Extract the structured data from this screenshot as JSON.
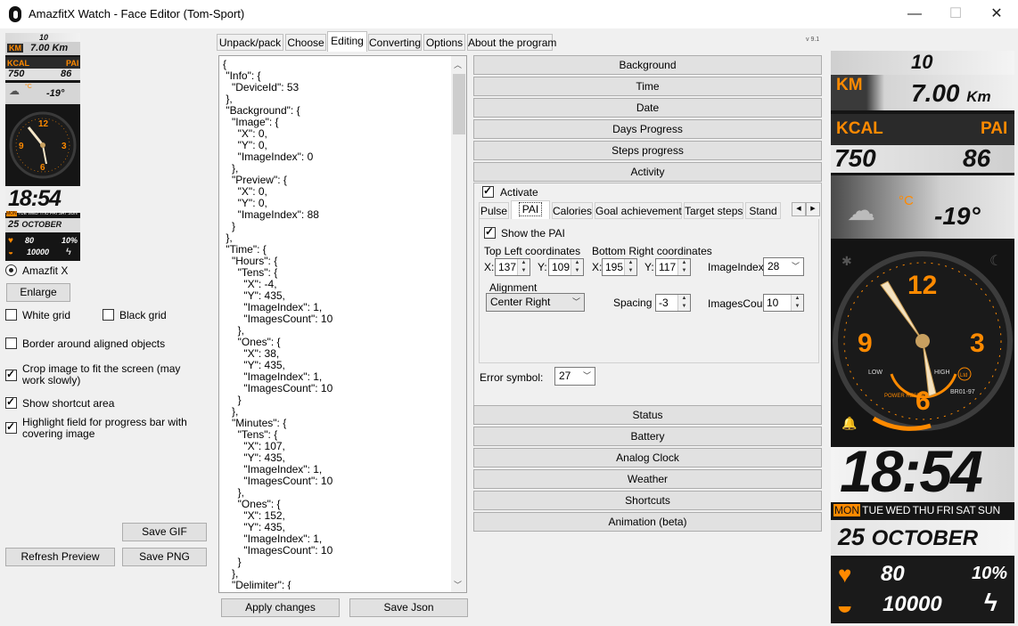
{
  "window": {
    "title": "AmazfitX Watch - Face Editor (Tom-Sport)",
    "minimize": "—",
    "maximize": "☐",
    "close": "✕"
  },
  "version": "v 9.1",
  "tabs": [
    "Unpack/pack",
    "Choose",
    "Editing",
    "Converting",
    "Options",
    "About the program"
  ],
  "left": {
    "device_radio": "Amazfit X",
    "enlarge": "Enlarge",
    "white_grid": "White grid",
    "black_grid": "Black grid",
    "border_aligned": "Border around aligned objects",
    "crop_image": "Crop image to fit the screen (may work slowly)",
    "show_shortcut": "Show shortcut area",
    "highlight_field": "Highlight field for progress bar with covering image",
    "save_gif": "Save GIF",
    "refresh_preview": "Refresh Preview",
    "save_png": "Save PNG"
  },
  "json_text": "{\n \"Info\": {\n   \"DeviceId\": 53\n },\n \"Background\": {\n   \"Image\": {\n     \"X\": 0,\n     \"Y\": 0,\n     \"ImageIndex\": 0\n   },\n   \"Preview\": {\n     \"X\": 0,\n     \"Y\": 0,\n     \"ImageIndex\": 88\n   }\n },\n \"Time\": {\n   \"Hours\": {\n     \"Tens\": {\n       \"X\": -4,\n       \"Y\": 435,\n       \"ImageIndex\": 1,\n       \"ImagesCount\": 10\n     },\n     \"Ones\": {\n       \"X\": 38,\n       \"Y\": 435,\n       \"ImageIndex\": 1,\n       \"ImagesCount\": 10\n     }\n   },\n   \"Minutes\": {\n     \"Tens\": {\n       \"X\": 107,\n       \"Y\": 435,\n       \"ImageIndex\": 1,\n       \"ImagesCount\": 10\n     },\n     \"Ones\": {\n       \"X\": 152,\n       \"Y\": 435,\n       \"ImageIndex\": 1,\n       \"ImagesCount\": 10\n     }\n   },\n   \"Delimiter\": {",
  "editor_buttons": {
    "apply": "Apply changes",
    "save_json": "Save Json"
  },
  "sections_top": [
    "Background",
    "Time",
    "Date",
    "Days Progress",
    "Steps progress",
    "Activity"
  ],
  "sections_bottom": [
    "Status",
    "Battery",
    "Analog Clock",
    "Weather",
    "Shortcuts",
    "Animation (beta)"
  ],
  "activity": {
    "activate": "Activate",
    "subtabs": [
      "Pulse",
      "PAI",
      "Calories",
      "Goal achievement",
      "Target steps",
      "Stand"
    ],
    "show_pai": "Show the PAI",
    "top_left_label": "Top Left coordinates",
    "bottom_right_label": "Bottom Right coordinates",
    "x_label": "X:",
    "y_label": "Y:",
    "tl_x": "137",
    "tl_y": "109",
    "br_x": "195",
    "br_y": "117",
    "image_index_label": "ImageIndex:",
    "image_index": "28",
    "alignment_label": "Alignment",
    "alignment": "Center Right",
    "spacing_label": "Spacing",
    "spacing": "-3",
    "images_count_label": "ImagesCount",
    "images_count": "10",
    "error_label": "Error symbol:",
    "error_value": "27"
  },
  "watch": {
    "top_num": "10",
    "km_label": "KM",
    "km_value": "7.00",
    "km_unit": "Km",
    "kcal_label": "KCAL",
    "pai_label": "PAI",
    "kcal_value": "750",
    "pai_value": "86",
    "temp_unit": "°C",
    "temp_value": "-19°",
    "dial_12": "12",
    "dial_9": "9",
    "dial_3": "3",
    "dial_6": "6",
    "dial_low": "LOW",
    "dial_high": "HIGH",
    "dial_ltd": "Ltd",
    "dial_power": "POWER RESERVE",
    "dial_model": "BR01-97",
    "time": "18:54",
    "days": [
      "MON",
      "TUE",
      "WED",
      "THU",
      "FRI",
      "SAT",
      "SUN"
    ],
    "date_day": "25",
    "date_month": "OCTOBER",
    "heart_value": "80",
    "battery_value": "10%",
    "steps_value": "10000"
  }
}
